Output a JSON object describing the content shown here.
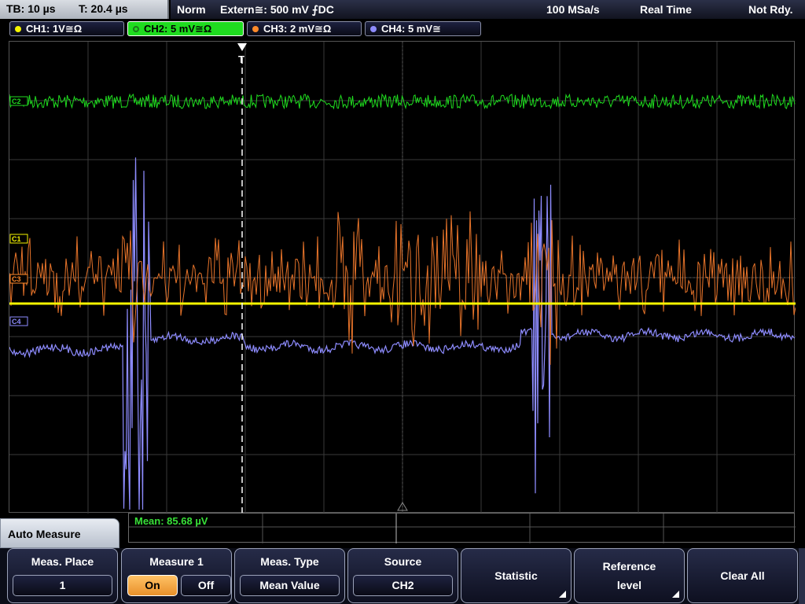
{
  "status": {
    "timebase": "TB: 10 µs",
    "trigger_time": "T: 20.4 µs",
    "mode": "Norm",
    "trigger_source": "Extern≅: 500 mV ⨍DC",
    "sample_rate": "100 MSa/s",
    "acq_mode": "Real Time",
    "state": "Not Rdy."
  },
  "channels": [
    {
      "label": "CH1: 1V≅Ω",
      "color": "#f5f500"
    },
    {
      "label": "CH2: 5 mV≅Ω",
      "color": "#1fdc1f",
      "active": true
    },
    {
      "label": "CH3: 2 mV≅Ω",
      "color": "#ff8a2a"
    },
    {
      "label": "CH4: 5 mV≅",
      "color": "#8e8cff"
    }
  ],
  "markers": {
    "c2": "C2",
    "c1": "C1",
    "c3": "C3",
    "c4": "C4",
    "trigger": "T"
  },
  "measurement": {
    "readout": "Mean: 85.68 µV"
  },
  "menu": {
    "title": "Auto Measure",
    "meas_place": {
      "title": "Meas. Place",
      "value": "1"
    },
    "measure": {
      "title": "Measure 1",
      "on": "On",
      "off": "Off"
    },
    "meas_type": {
      "title": "Meas. Type",
      "value": "Mean Value"
    },
    "source": {
      "title": "Source",
      "value": "CH2"
    },
    "statistic": {
      "label": "Statistic"
    },
    "reference": {
      "line1": "Reference",
      "line2": "level"
    },
    "clear_all": {
      "label": "Clear All"
    }
  }
}
